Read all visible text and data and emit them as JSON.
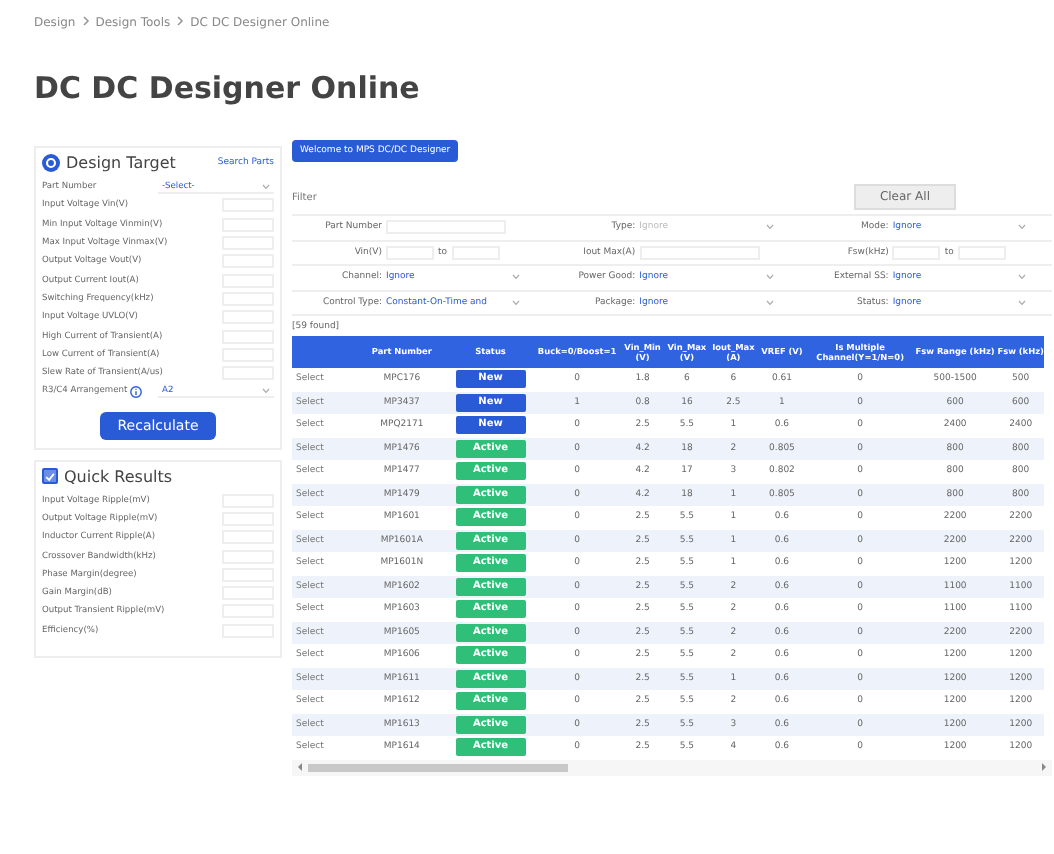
{
  "breadcrumb": [
    "Design",
    "Design Tools",
    "DC DC Designer Online"
  ],
  "title": "DC DC Designer Online",
  "design_target": {
    "title": "Design Target",
    "link": "Search Parts",
    "fields": [
      {
        "label": "Part Number",
        "kind": "select",
        "value": "-Select-"
      },
      {
        "label": "Input Voltage Vin(V)",
        "kind": "input"
      },
      {
        "label": "Min Input Voltage Vinmin(V)",
        "kind": "input"
      },
      {
        "label": "Max Input Voltage Vinmax(V)",
        "kind": "input"
      },
      {
        "label": "Output Voltage Vout(V)",
        "kind": "input"
      },
      {
        "label": "Output Current Iout(A)",
        "kind": "input"
      },
      {
        "label": "Switching Frequency(kHz)",
        "kind": "input"
      },
      {
        "label": "Input Voltage UVLO(V)",
        "kind": "input"
      },
      {
        "label": "High Current of Transient(A)",
        "kind": "input"
      },
      {
        "label": "Low Current of Transient(A)",
        "kind": "input"
      },
      {
        "label": "Slew Rate of Transient(A/us)",
        "kind": "input"
      },
      {
        "label": "R3/C4 Arrangement",
        "kind": "select",
        "value": "A2",
        "info": true
      }
    ],
    "button": "Recalculate"
  },
  "quick_results": {
    "title": "Quick Results",
    "checked": true,
    "fields": [
      "Input Voltage Ripple(mV)",
      "Output Voltage Ripple(mV)",
      "Inductor Current Ripple(A)",
      "Crossover Bandwidth(kHz)",
      "Phase Margin(degree)",
      "Gain Margin(dB)",
      "Output Transient Ripple(mV)",
      "Efficiency(%)"
    ]
  },
  "welcome_button": "Welcome to MPS DC/DC Designer",
  "filter": {
    "label": "Filter",
    "clear_button": "Clear All",
    "rows": [
      [
        {
          "label": "Part Number",
          "kind": "input"
        },
        {
          "label": "Type:",
          "kind": "select",
          "value": "Ignore",
          "disabled": true
        },
        {
          "label": "Mode:",
          "kind": "select",
          "value": "Ignore"
        }
      ],
      [
        {
          "label": "Vin(V)",
          "kind": "range",
          "sep": "to"
        },
        {
          "label": "Iout Max(A)",
          "kind": "input"
        },
        {
          "label": "Fsw(kHz)",
          "kind": "range",
          "sep": "to"
        }
      ],
      [
        {
          "label": "Channel:",
          "kind": "select",
          "value": "Ignore"
        },
        {
          "label": "Power Good:",
          "kind": "select",
          "value": "Ignore"
        },
        {
          "label": "External SS:",
          "kind": "select",
          "value": "Ignore"
        }
      ],
      [
        {
          "label": "Control Type:",
          "kind": "select",
          "value": "Constant-On-Time and"
        },
        {
          "label": "Package:",
          "kind": "select",
          "value": "Ignore"
        },
        {
          "label": "Status:",
          "kind": "select",
          "value": "Ignore"
        }
      ]
    ],
    "found": "[59 found]"
  },
  "table": {
    "columns": [
      "",
      "Part Number",
      "Status",
      "Buck=0/Boost=1",
      "Vin_Min (V)",
      "Vin_Max (V)",
      "Iout_Max (A)",
      "VREF (V)",
      "Is Multiple Channel(Y=1/N=0)",
      "Fsw Range (kHz)",
      "Fsw (kHz)"
    ],
    "rows": [
      {
        "cells": [
          "Select",
          "MPC176",
          "New",
          "0",
          "1.8",
          "6",
          "6",
          "0.61",
          "0",
          "500-1500",
          "500"
        ]
      },
      {
        "cells": [
          "Select",
          "MP3437",
          "New",
          "1",
          "0.8",
          "16",
          "2.5",
          "1",
          "0",
          "600",
          "600"
        ]
      },
      {
        "cells": [
          "Select",
          "MPQ2171",
          "New",
          "0",
          "2.5",
          "5.5",
          "1",
          "0.6",
          "0",
          "2400",
          "2400"
        ]
      },
      {
        "cells": [
          "Select",
          "MP1476",
          "Active",
          "0",
          "4.2",
          "18",
          "2",
          "0.805",
          "0",
          "800",
          "800"
        ]
      },
      {
        "cells": [
          "Select",
          "MP1477",
          "Active",
          "0",
          "4.2",
          "17",
          "3",
          "0.802",
          "0",
          "800",
          "800"
        ]
      },
      {
        "cells": [
          "Select",
          "MP1479",
          "Active",
          "0",
          "4.2",
          "18",
          "1",
          "0.805",
          "0",
          "800",
          "800"
        ]
      },
      {
        "cells": [
          "Select",
          "MP1601",
          "Active",
          "0",
          "2.5",
          "5.5",
          "1",
          "0.6",
          "0",
          "2200",
          "2200"
        ]
      },
      {
        "cells": [
          "Select",
          "MP1601A",
          "Active",
          "0",
          "2.5",
          "5.5",
          "1",
          "0.6",
          "0",
          "2200",
          "2200"
        ]
      },
      {
        "cells": [
          "Select",
          "MP1601N",
          "Active",
          "0",
          "2.5",
          "5.5",
          "1",
          "0.6",
          "0",
          "1200",
          "1200"
        ]
      },
      {
        "cells": [
          "Select",
          "MP1602",
          "Active",
          "0",
          "2.5",
          "5.5",
          "2",
          "0.6",
          "0",
          "1100",
          "1100"
        ]
      },
      {
        "cells": [
          "Select",
          "MP1603",
          "Active",
          "0",
          "2.5",
          "5.5",
          "2",
          "0.6",
          "0",
          "1100",
          "1100"
        ]
      },
      {
        "cells": [
          "Select",
          "MP1605",
          "Active",
          "0",
          "2.5",
          "5.5",
          "2",
          "0.6",
          "0",
          "2200",
          "2200"
        ]
      },
      {
        "cells": [
          "Select",
          "MP1606",
          "Active",
          "0",
          "2.5",
          "5.5",
          "2",
          "0.6",
          "0",
          "1200",
          "1200"
        ]
      },
      {
        "cells": [
          "Select",
          "MP1611",
          "Active",
          "0",
          "2.5",
          "5.5",
          "1",
          "0.6",
          "0",
          "1200",
          "1200"
        ]
      },
      {
        "cells": [
          "Select",
          "MP1612",
          "Active",
          "0",
          "2.5",
          "5.5",
          "2",
          "0.6",
          "0",
          "1200",
          "1200"
        ]
      },
      {
        "cells": [
          "Select",
          "MP1613",
          "Active",
          "0",
          "2.5",
          "5.5",
          "3",
          "0.6",
          "0",
          "1200",
          "1200"
        ]
      },
      {
        "cells": [
          "Select",
          "MP1614",
          "Active",
          "0",
          "2.5",
          "5.5",
          "4",
          "0.6",
          "0",
          "1200",
          "1200"
        ]
      }
    ]
  }
}
